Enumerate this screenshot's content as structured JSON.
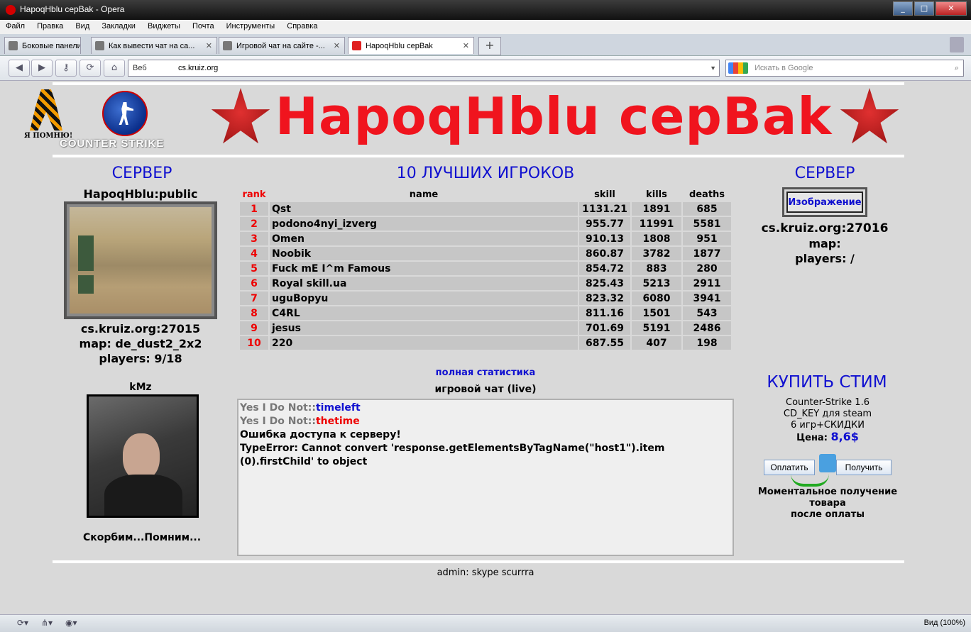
{
  "window": {
    "title": "HapoqHblu cepBak - Opera",
    "min": "_",
    "max": "□",
    "close": "✕"
  },
  "menu": [
    "Файл",
    "Правка",
    "Вид",
    "Закладки",
    "Виджеты",
    "Почта",
    "Инструменты",
    "Справка"
  ],
  "tabs": [
    {
      "label": "Боковые панели"
    },
    {
      "label": "Как вывести чат на са...",
      "close": "✕"
    },
    {
      "label": "Игровой чат на сайте -...",
      "close": "✕"
    },
    {
      "label": "HapoqHblu cepBak",
      "close": "✕"
    }
  ],
  "toolbar": {
    "newtab": "+",
    "back": "◀",
    "forward": "▶",
    "key": "⚷",
    "reload": "⟳",
    "home": "⌂"
  },
  "address": {
    "web_label": "Веб",
    "url": "cs.kruiz.org",
    "dropdown": "▼"
  },
  "search": {
    "placeholder": "Искать в Google",
    "icon": "⌕"
  },
  "header": {
    "memory_text": "Я ПОМНЮ!",
    "cs_logo_text": "COUNTER STRIKE",
    "title": "HapoqHblu cepBak"
  },
  "left": {
    "section_title": "СЕРВЕР",
    "server_name": "HapoqHblu:public",
    "address": "cs.kruiz.org:27015",
    "map": "map: de_dust2_2x2",
    "players": "players: 9/18",
    "person_name": "kMz",
    "memorial": "Скорбим...Помним..."
  },
  "center": {
    "title": "10 ЛУЧШИХ ИГРОКОВ",
    "columns": [
      "rank",
      "name",
      "skill",
      "kills",
      "deaths"
    ],
    "rows": [
      [
        "1",
        "Qst",
        "1131.21",
        "1891",
        "685"
      ],
      [
        "2",
        "podono4nyi_izverg",
        "955.77",
        "11991",
        "5581"
      ],
      [
        "3",
        "Omen",
        "910.13",
        "1808",
        "951"
      ],
      [
        "4",
        "Noobik",
        "860.87",
        "3782",
        "1877"
      ],
      [
        "5",
        "Fuck mE I^m Famous",
        "854.72",
        "883",
        "280"
      ],
      [
        "6",
        "Royal skill.ua",
        "825.43",
        "5213",
        "2911"
      ],
      [
        "7",
        "uguBopyu",
        "823.32",
        "6080",
        "3941"
      ],
      [
        "8",
        "C4RL",
        "811.16",
        "1501",
        "543"
      ],
      [
        "9",
        "jesus",
        "701.69",
        "5191",
        "2486"
      ],
      [
        "10",
        "220",
        "687.55",
        "407",
        "198"
      ]
    ],
    "full_stats_link": "полная статистика",
    "chat_label": "игровой чат (live)",
    "chat": {
      "line1_user": "Yes I Do Not::",
      "line1_msg": "timeleft",
      "line2_user": "Yes I Do Not::",
      "line2_msg": "thetime",
      "line3": "Ошибка доступа к серверу!",
      "line4": "TypeError: Cannot convert 'response.getElementsByTagName(\"host1\").item",
      "line5": "(0).firstChild' to object"
    }
  },
  "right": {
    "section_title": "СЕРВЕР",
    "image_alt": "Изображение",
    "address": "cs.kruiz.org:27016",
    "map": "map:",
    "players": "players: /",
    "buy_title": "КУПИТЬ СТИМ",
    "buy_line1": "Counter-Strike 1.6",
    "buy_line2": "CD_KEY для steam",
    "buy_line3": "6 игр+СКИДКИ",
    "price_label": "Цена:",
    "price_value": "8,6$",
    "pay_button": "Оплатить",
    "get_button": "Получить",
    "note_line1": "Моментальное получение товара",
    "note_line2": "после оплаты"
  },
  "footer": {
    "admin": "admin: skype scurrra"
  },
  "status": {
    "zoom": "Вид (100%)",
    "b1": "⟳▾",
    "b2": "⋔▾",
    "b3": "◉▾"
  },
  "colors": {
    "title_red": "#f0141e",
    "link_blue": "#1010d0",
    "rank_red": "#e00000"
  }
}
